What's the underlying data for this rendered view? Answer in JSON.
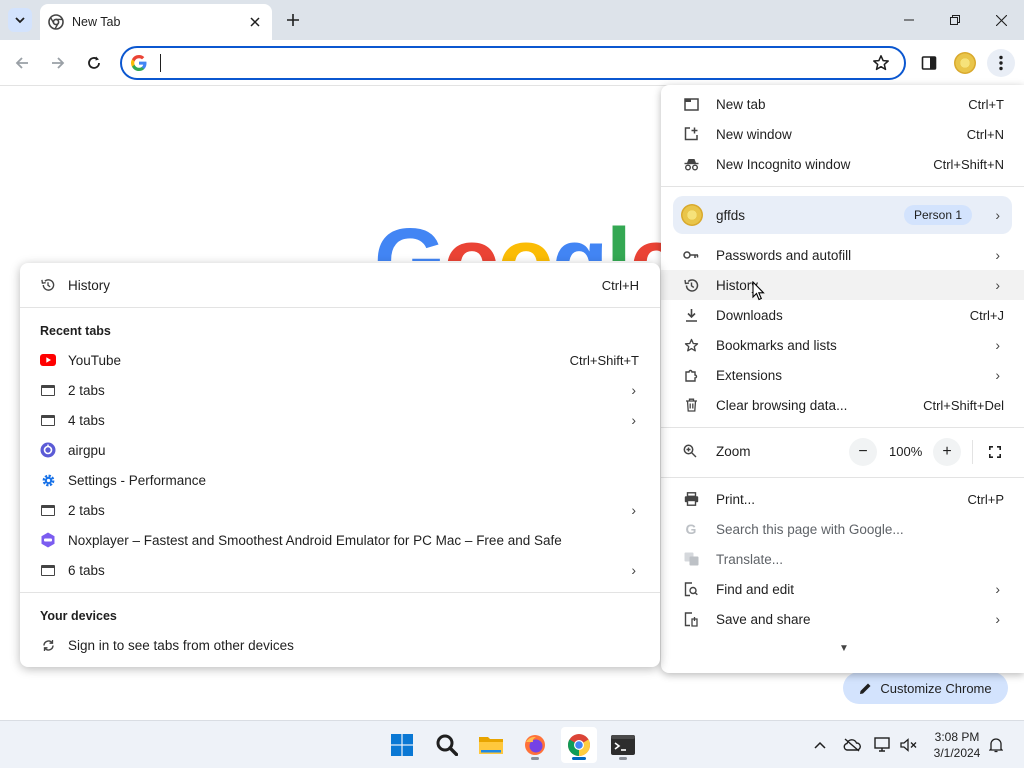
{
  "tab": {
    "title": "New Tab"
  },
  "omnibox": {
    "value": "",
    "placeholder": ""
  },
  "page": {
    "customize_label": "Customize Chrome"
  },
  "menu": {
    "items_top": [
      {
        "label": "New tab",
        "shortcut": "Ctrl+T",
        "icon": "new-tab-icon"
      },
      {
        "label": "New window",
        "shortcut": "Ctrl+N",
        "icon": "new-window-icon"
      },
      {
        "label": "New Incognito window",
        "shortcut": "Ctrl+Shift+N",
        "icon": "incognito-icon"
      }
    ],
    "profile": {
      "name": "gffds",
      "badge": "Person 1"
    },
    "items_mid": [
      {
        "label": "Passwords and autofill",
        "shortcut": "",
        "icon": "key-icon"
      },
      {
        "label": "History",
        "shortcut": "",
        "icon": "history-icon"
      },
      {
        "label": "Downloads",
        "shortcut": "Ctrl+J",
        "icon": "download-icon"
      },
      {
        "label": "Bookmarks and lists",
        "shortcut": "",
        "icon": "star-icon"
      },
      {
        "label": "Extensions",
        "shortcut": "",
        "icon": "puzzle-icon"
      },
      {
        "label": "Clear browsing data...",
        "shortcut": "Ctrl+Shift+Del",
        "icon": "trash-icon"
      }
    ],
    "zoom": {
      "label": "Zoom",
      "value": "100%",
      "minus": "−",
      "plus": "+"
    },
    "items_bottom": [
      {
        "label": "Print...",
        "shortcut": "Ctrl+P",
        "icon": "print-icon"
      },
      {
        "label": "Search this page with Google...",
        "shortcut": "",
        "icon": "google-icon"
      },
      {
        "label": "Translate...",
        "shortcut": "",
        "icon": "translate-icon"
      },
      {
        "label": "Find and edit",
        "shortcut": "",
        "icon": "find-icon"
      },
      {
        "label": "Save and share",
        "shortcut": "",
        "icon": "save-share-icon"
      }
    ]
  },
  "history_menu": {
    "history": {
      "label": "History",
      "shortcut": "Ctrl+H"
    },
    "recent_heading": "Recent tabs",
    "recent": [
      {
        "label": "YouTube",
        "shortcut": "Ctrl+Shift+T"
      },
      {
        "label": "2 tabs"
      },
      {
        "label": "4 tabs"
      },
      {
        "label": "airgpu"
      },
      {
        "label": "Settings - Performance"
      },
      {
        "label": "2 tabs"
      },
      {
        "label": "Noxplayer – Fastest and Smoothest Android Emulator for PC  Mac – Free and Safe"
      },
      {
        "label": "6 tabs"
      }
    ],
    "devices_heading": "Your devices",
    "devices_item": "Sign in to see tabs from other devices"
  },
  "taskbar": {
    "time": "3:08 PM",
    "date": "3/1/2024"
  },
  "colors": {
    "accent": "#0b57d0",
    "menu_highlight": "#f2f2f2",
    "profile_bg": "#e8eef8"
  }
}
